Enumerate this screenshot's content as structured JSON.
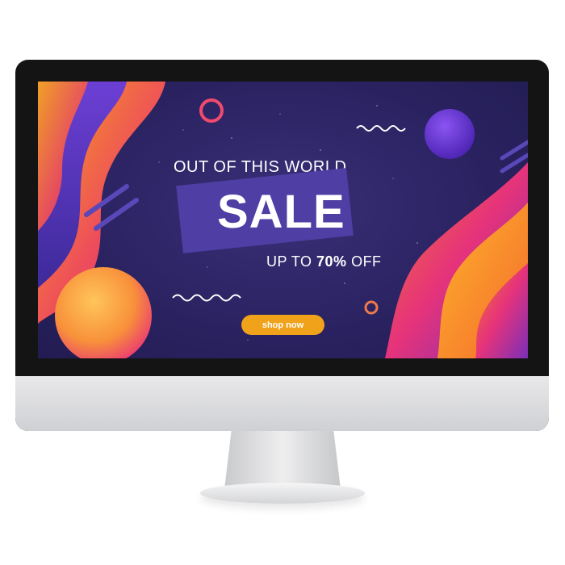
{
  "banner": {
    "headline": "OUT OF THIS WORLD",
    "title": "SALE",
    "subline_prefix": "UP TO ",
    "discount": "70%",
    "subline_suffix": " OFF",
    "cta_label": "shop now"
  },
  "colors": {
    "background": "#2b2362",
    "accent_orange": "#f0a21a",
    "accent_pink": "#e8336e",
    "accent_purple": "#6b3fd6"
  }
}
